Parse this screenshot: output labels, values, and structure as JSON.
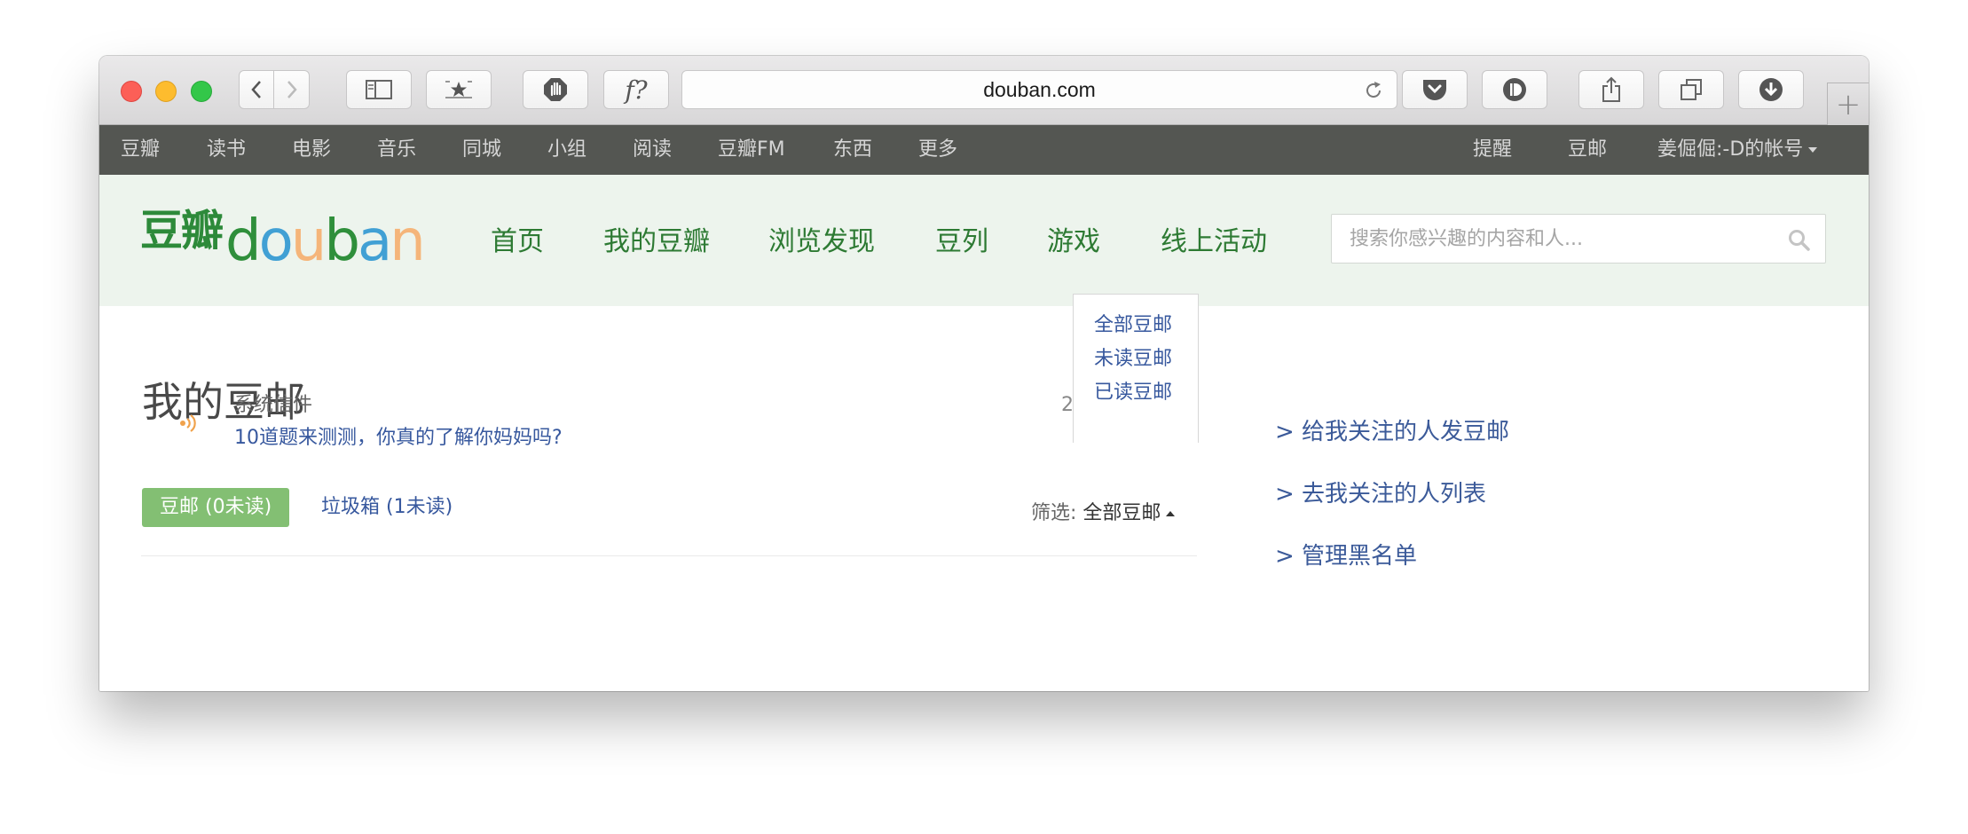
{
  "browser": {
    "url": "douban.com",
    "newtab_symbol": "+",
    "f_button_label": "f?"
  },
  "global_nav": {
    "left": [
      "豆瓣",
      "读书",
      "电影",
      "音乐",
      "同城",
      "小组",
      "阅读",
      "豆瓣FM",
      "东西",
      "更多"
    ],
    "right": [
      "提醒",
      "豆邮",
      "姜倔倔:-D的帐号"
    ]
  },
  "header": {
    "logo_cn": "豆瓣",
    "logo_en_letters": [
      "d",
      "o",
      "u",
      "b",
      "a",
      "n"
    ],
    "logo_en_colors": [
      "#2f8f3b",
      "#41a0d4",
      "#f5b57a",
      "#2f8f3b",
      "#41a0d4",
      "#f5b57a"
    ],
    "nav": [
      "首页",
      "我的豆瓣",
      "浏览发现",
      "豆列",
      "游戏",
      "线上活动"
    ],
    "search_placeholder": "搜索你感兴趣的内容和人..."
  },
  "mail": {
    "title": "我的豆邮",
    "tab_inbox": "豆邮 (0未读)",
    "tab_trash": "垃圾箱 (1未读)",
    "filter_label": "筛选:",
    "filter_value": "全部豆邮",
    "filter_options": [
      "全部豆邮",
      "未读豆邮",
      "已读豆邮"
    ],
    "messages": [
      {
        "sender": "系统信件",
        "subject": "10道题来测测，你真的了解你妈妈吗?",
        "date_partial": "2"
      }
    ]
  },
  "side_links": [
    "> 给我关注的人发豆邮",
    "> 去我关注的人列表",
    "> 管理黑名单"
  ],
  "colors": {
    "douban_green": "#2d8a3a",
    "nav_bg": "#545652",
    "header_bg": "#edf4ed",
    "active_tab": "#83bf73",
    "link_blue": "#37589e"
  }
}
